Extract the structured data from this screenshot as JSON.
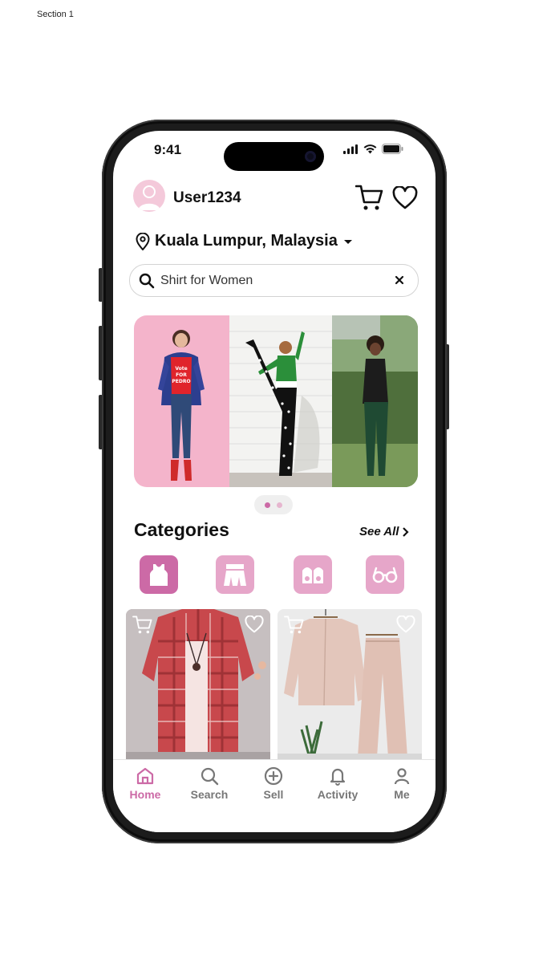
{
  "page": {
    "section_label": "Section 1"
  },
  "status_bar": {
    "time": "9:41"
  },
  "header": {
    "username": "User1234",
    "cart_icon": "cart-icon",
    "heart_icon": "heart-icon"
  },
  "location": {
    "label": "Kuala Lumpur, Malaysia",
    "icon": "map-pin-icon"
  },
  "search": {
    "value": "Shirt for Women",
    "icon": "search-icon",
    "clear_icon": "close-icon"
  },
  "banner": {
    "slides": [
      "slide-1",
      "slide-2"
    ],
    "active_slide": 1,
    "shirt_print": [
      "Vote",
      "FOR",
      "PEDRO"
    ]
  },
  "categories": {
    "title": "Categories",
    "see_all": "See All",
    "items": [
      {
        "icon": "top-icon",
        "active": true
      },
      {
        "icon": "skirt-icon",
        "active": false
      },
      {
        "icon": "shoes-icon",
        "active": false
      },
      {
        "icon": "glasses-icon",
        "active": false
      }
    ]
  },
  "products": [
    {
      "image": "plaid-shirt-image"
    },
    {
      "image": "beige-set-image"
    }
  ],
  "tabbar": {
    "items": [
      {
        "label": "Home",
        "icon": "home-icon",
        "active": true
      },
      {
        "label": "Search",
        "icon": "search-icon",
        "active": false
      },
      {
        "label": "Sell",
        "icon": "plus-circle-icon",
        "active": false
      },
      {
        "label": "Activity",
        "icon": "bell-icon",
        "active": false
      },
      {
        "label": "Me",
        "icon": "user-icon",
        "active": false
      }
    ]
  },
  "colors": {
    "accent": "#cc6aa6",
    "accent_light": "#e6a6c9",
    "avatar_bg": "#f4c9da",
    "text": "#111111",
    "muted": "#777777"
  }
}
